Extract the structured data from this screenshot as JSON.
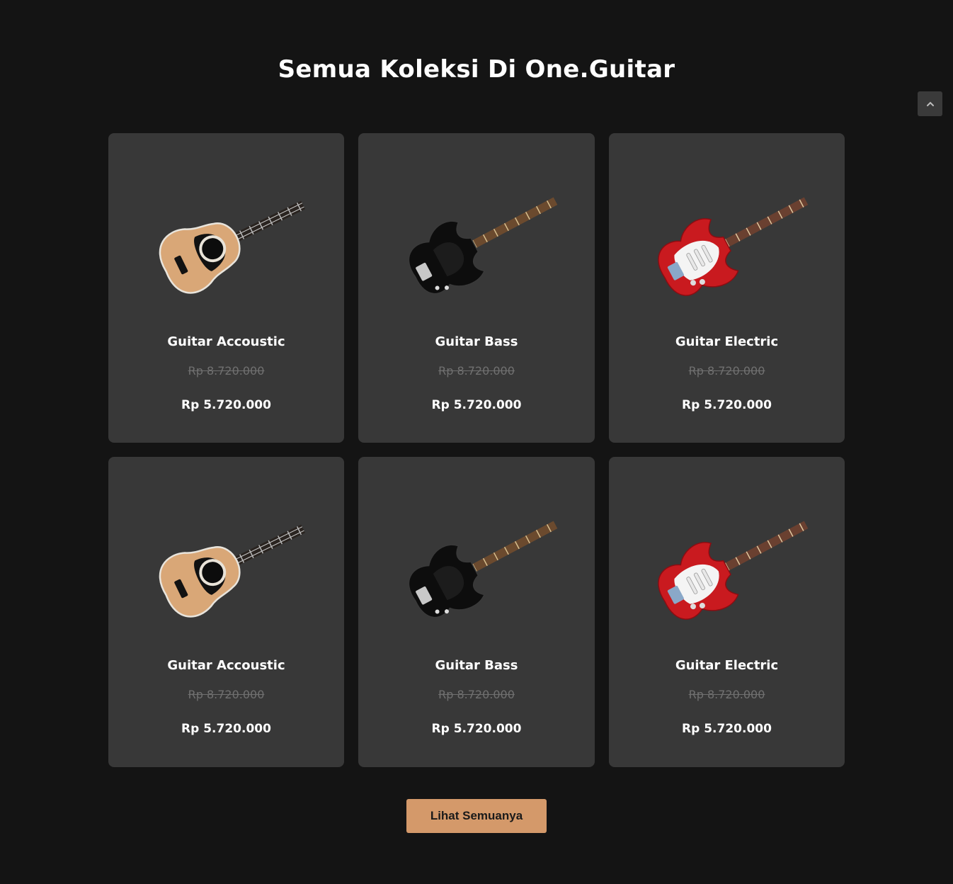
{
  "section": {
    "title": "Semua Koleksi Di One.Guitar"
  },
  "products": [
    {
      "name": "Guitar Accoustic",
      "old_price": "Rp 8.720.000",
      "price": "Rp 5.720.000",
      "image": "acoustic-guitar"
    },
    {
      "name": "Guitar Bass",
      "old_price": "Rp 8.720.000",
      "price": "Rp 5.720.000",
      "image": "bass-guitar"
    },
    {
      "name": "Guitar Electric",
      "old_price": "Rp 8.720.000",
      "price": "Rp 5.720.000",
      "image": "electric-guitar"
    },
    {
      "name": "Guitar Accoustic",
      "old_price": "Rp 8.720.000",
      "price": "Rp 5.720.000",
      "image": "acoustic-guitar"
    },
    {
      "name": "Guitar Bass",
      "old_price": "Rp 8.720.000",
      "price": "Rp 5.720.000",
      "image": "bass-guitar"
    },
    {
      "name": "Guitar Electric",
      "old_price": "Rp 8.720.000",
      "price": "Rp 5.720.000",
      "image": "electric-guitar"
    }
  ],
  "cta": {
    "label": "Lihat Semuanya"
  },
  "icons": {
    "scroll_top": "chevron-up-icon"
  },
  "colors": {
    "background": "#141414",
    "card": "#383838",
    "accent": "#d4996a",
    "strike_price": "#707070"
  }
}
